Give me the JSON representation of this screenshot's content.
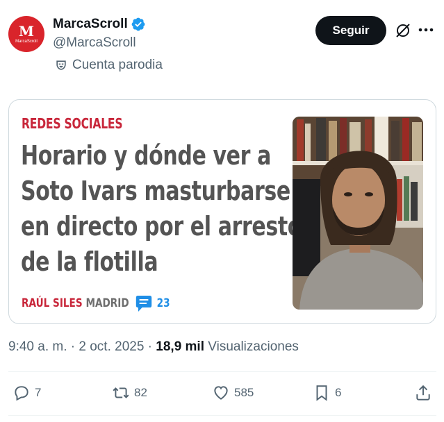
{
  "author": {
    "display_name": "MarcaScroll",
    "handle": "@MarcaScroll",
    "parody_label": "Cuenta parodia",
    "avatar_letter": "M",
    "avatar_wordmark": "MarcaScroll",
    "verified": true
  },
  "header": {
    "follow_label": "Seguir",
    "grok_icon": "grok-icon",
    "more_icon": "more-icon"
  },
  "card": {
    "kicker": "REDES SOCIALES",
    "headline": "Horario y dónde ver a Soto Ivars masturbarse en directo por el arresto de la flotilla",
    "byline_author": "RAÚL SILES",
    "byline_city": "MADRID",
    "comment_count": "23"
  },
  "meta": {
    "timestamp": "9:40 a. m. · 2 oct. 2025 · ",
    "views_number": "18,9 mil",
    "views_label": " Visualizaciones"
  },
  "actions": {
    "replies": "7",
    "reposts": "82",
    "likes": "585",
    "bookmarks": "6"
  },
  "colors": {
    "accent_red": "#c8263a",
    "brand_red": "#d9242b",
    "verified_blue": "#1d9bf0",
    "text_secondary": "#536471"
  }
}
